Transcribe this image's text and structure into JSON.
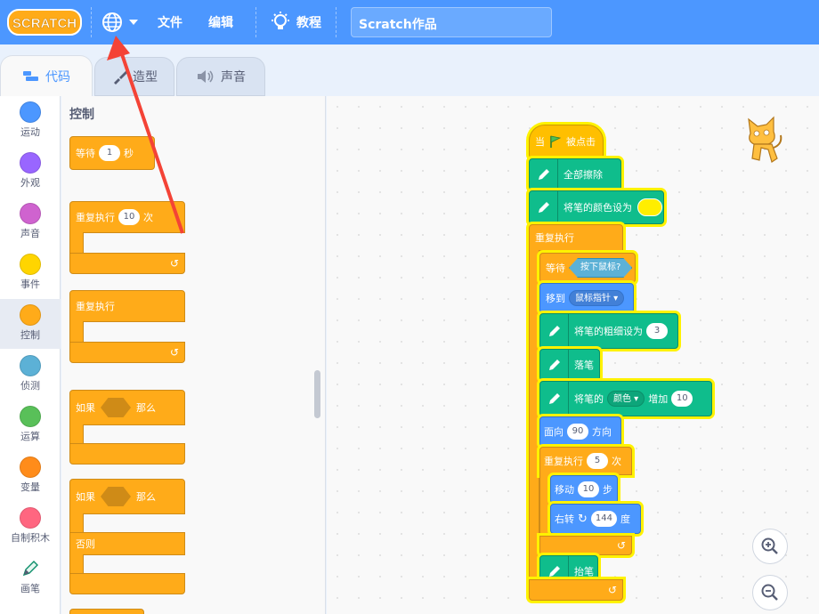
{
  "menu": {
    "logo_text": "SCRATCH",
    "file": "文件",
    "edit": "编辑",
    "tutorials": "教程",
    "project_title": "Scratch作品"
  },
  "tabs": {
    "code": "代码",
    "costumes": "造型",
    "sounds": "声音"
  },
  "categories": [
    {
      "label": "运动",
      "color": "#4c97ff"
    },
    {
      "label": "外观",
      "color": "#9966ff"
    },
    {
      "label": "声音",
      "color": "#cf63cf"
    },
    {
      "label": "事件",
      "color": "#ffd500"
    },
    {
      "label": "控制",
      "color": "#ffab19"
    },
    {
      "label": "侦测",
      "color": "#5cb1d6"
    },
    {
      "label": "运算",
      "color": "#59c059"
    },
    {
      "label": "变量",
      "color": "#ff8c1a"
    },
    {
      "label": "自制积木",
      "color": "#ff6680"
    },
    {
      "label": "画笔",
      "color": "#0fbd8c"
    }
  ],
  "palette": {
    "title": "控制",
    "wait": {
      "label": "等待",
      "value": "1",
      "unit": "秒"
    },
    "repeat": {
      "label": "重复执行",
      "value": "10",
      "unit": "次"
    },
    "forever": {
      "label": "重复执行"
    },
    "if_then": {
      "if": "如果",
      "then": "那么"
    },
    "if_else": {
      "if": "如果",
      "then": "那么",
      "else": "否则"
    }
  },
  "script": {
    "hat": {
      "when": "当",
      "clicked": "被点击"
    },
    "clear": "全部擦除",
    "set_color": "将笔的颜色设为",
    "forever": "重复执行",
    "wait_until": "等待",
    "mouse_down": "按下鼠标?",
    "go_to": "移到",
    "mouse_pointer": "鼠标指针",
    "set_size": {
      "label": "将笔的粗细设为",
      "value": "3"
    },
    "pen_down": "落笔",
    "change_pen": {
      "label": "将笔的",
      "param": "颜色",
      "inc": "增加",
      "value": "10"
    },
    "point": {
      "label": "面向",
      "value": "90",
      "unit": "方向"
    },
    "repeat": {
      "label": "重复执行",
      "value": "5",
      "unit": "次"
    },
    "move": {
      "label": "移动",
      "value": "10",
      "unit": "步"
    },
    "turn": {
      "label": "右转",
      "value": "144",
      "unit": "度"
    },
    "pen_up": "抬笔"
  },
  "colors": {
    "menu_bg": "#4c97ff",
    "control": "#ffab19",
    "pen": "#0fbd8c",
    "motion": "#4c97ff",
    "highlight": "#fff200",
    "pen_color_swatch": "#ffee00"
  }
}
